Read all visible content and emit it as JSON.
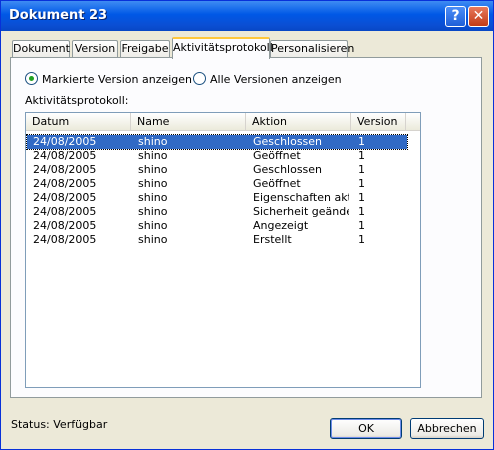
{
  "window": {
    "title": "Dokument 23",
    "help_icon": "?",
    "close_icon": "✕"
  },
  "tabs": [
    {
      "label": "Dokument"
    },
    {
      "label": "Version"
    },
    {
      "label": "Freigabe"
    },
    {
      "label": "Aktivitätsprotokoll"
    },
    {
      "label": "Personalisieren"
    }
  ],
  "active_tab": "Aktivitätsprotokoll",
  "options": {
    "marked": "Markierte Version anzeigen",
    "all": "Alle Versionen anzeigen",
    "selected": "marked"
  },
  "log_label": "Aktivitätsprotokoll:",
  "columns": {
    "date": "Datum",
    "name": "Name",
    "action": "Aktion",
    "version": "Version"
  },
  "rows": [
    {
      "date": "24/08/2005",
      "name": "shino",
      "action": "Geschlossen",
      "version": "1"
    },
    {
      "date": "24/08/2005",
      "name": "shino",
      "action": "Geöffnet",
      "version": "1"
    },
    {
      "date": "24/08/2005",
      "name": "shino",
      "action": "Geschlossen",
      "version": "1"
    },
    {
      "date": "24/08/2005",
      "name": "shino",
      "action": "Geöffnet",
      "version": "1"
    },
    {
      "date": "24/08/2005",
      "name": "shino",
      "action": "Eigenschaften aktua",
      "version": "1"
    },
    {
      "date": "24/08/2005",
      "name": "shino",
      "action": "Sicherheit geändert",
      "version": "1"
    },
    {
      "date": "24/08/2005",
      "name": "shino",
      "action": "Angezeigt",
      "version": "1"
    },
    {
      "date": "24/08/2005",
      "name": "shino",
      "action": "Erstellt",
      "version": "1"
    }
  ],
  "selected_row": 0,
  "status": "Status: Verfügbar",
  "buttons": {
    "ok": "OK",
    "cancel": "Abbrechen"
  },
  "colors": {
    "titlebar": "#0058e6",
    "selection": "#316ac5",
    "active_tab_accent": "#ffc83c"
  }
}
